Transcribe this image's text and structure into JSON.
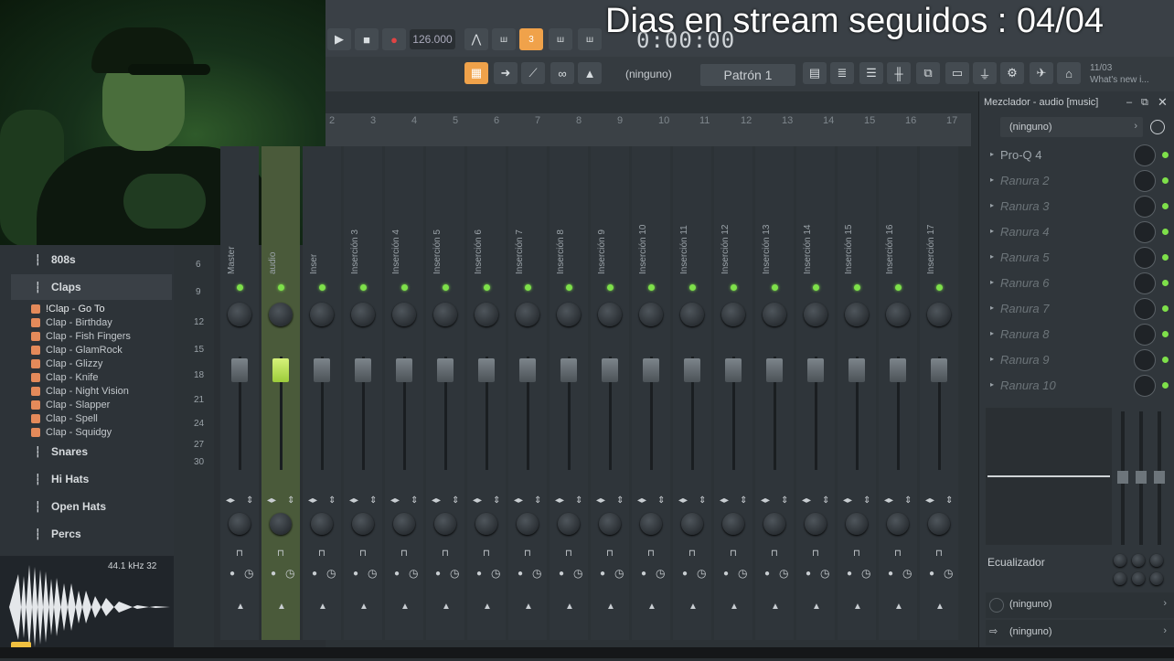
{
  "overlay": {
    "title": "Dias en stream seguidos : 04/04"
  },
  "transport": {
    "tempo": "126.000",
    "time": "0:00:00",
    "pattern_label": "Patrón 1",
    "preset_label": "(ninguno)",
    "news_date": "11/03",
    "news_text": "What's new i..."
  },
  "browser": {
    "folders": [
      {
        "label": "808s"
      },
      {
        "label": "Claps"
      },
      {
        "label": "Snares"
      },
      {
        "label": "Hi Hats"
      },
      {
        "label": "Open Hats"
      },
      {
        "label": "Percs"
      }
    ],
    "files": [
      "!Clap - Go To",
      "Clap - Birthday",
      "Clap - Fish Fingers",
      "Clap - GlamRock",
      "Clap - Glizzy",
      "Clap - Knife",
      "Clap - Night Vision",
      "Clap - Slapper",
      "Clap - Spell",
      "Clap - Squidgy"
    ],
    "sample_info": "44.1 kHz 32"
  },
  "mixer": {
    "scale": [
      "6",
      "9",
      "12",
      "15",
      "18",
      "21",
      "24",
      "27",
      "30"
    ],
    "ruler": [
      "2",
      "3",
      "4",
      "5",
      "6",
      "7",
      "8",
      "9",
      "10",
      "11",
      "12",
      "13",
      "14",
      "15",
      "16",
      "17"
    ],
    "tracks": [
      {
        "name": "Master",
        "selected": false
      },
      {
        "name": "audio",
        "selected": true
      },
      {
        "name": "Inser",
        "selected": false
      },
      {
        "name": "Inserción 3",
        "selected": false
      },
      {
        "name": "Inserción 4",
        "selected": false
      },
      {
        "name": "Inserción 5",
        "selected": false
      },
      {
        "name": "Inserción 6",
        "selected": false
      },
      {
        "name": "Inserción 7",
        "selected": false
      },
      {
        "name": "Inserción 8",
        "selected": false
      },
      {
        "name": "Inserción 9",
        "selected": false
      },
      {
        "name": "Inserción 10",
        "selected": false
      },
      {
        "name": "Inserción 11",
        "selected": false
      },
      {
        "name": "Inserción 12",
        "selected": false
      },
      {
        "name": "Inserción 13",
        "selected": false
      },
      {
        "name": "Inserción 14",
        "selected": false
      },
      {
        "name": "Inserción 15",
        "selected": false
      },
      {
        "name": "Inserción 16",
        "selected": false
      },
      {
        "name": "Inserción 17",
        "selected": false
      }
    ]
  },
  "panel": {
    "title": "Mezclador - audio [music]",
    "preset": "(ninguno)",
    "slots": [
      "Pro-Q 4",
      "Ranura 2",
      "Ranura 3",
      "Ranura 4",
      "Ranura 5",
      "Ranura 6",
      "Ranura 7",
      "Ranura 8",
      "Ranura 9",
      "Ranura 10"
    ],
    "eq_label": "Ecualizador",
    "in_route": "(ninguno)",
    "out_route": "(ninguno)"
  },
  "colors": {
    "accent_green": "#7ee04a",
    "selected_fader": "#c8ea64",
    "orange_button": "#f0a24a"
  }
}
